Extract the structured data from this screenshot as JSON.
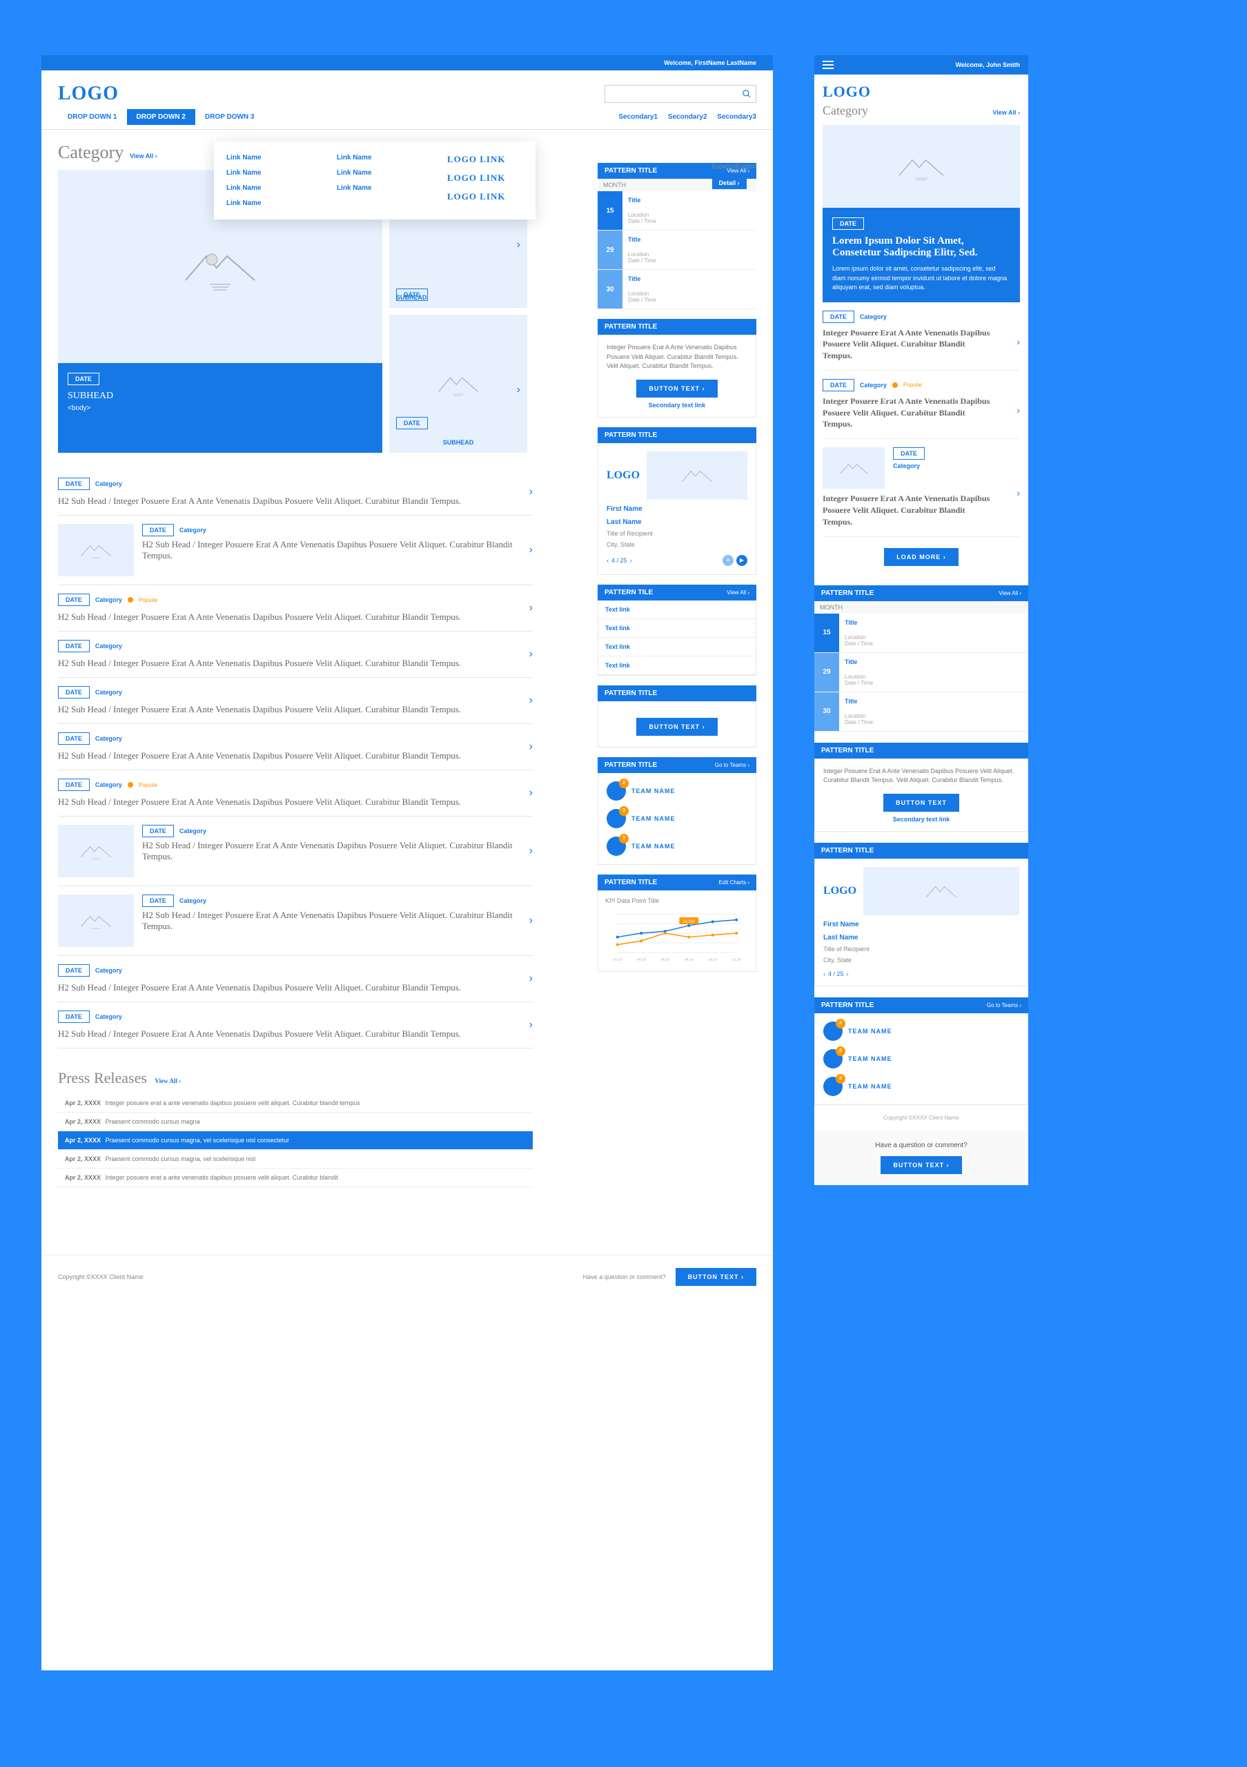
{
  "user_bar": {
    "welcome": "Welcome, FirstName LastName"
  },
  "logo": "LOGO",
  "nav": {
    "main": [
      "DROP DOWN 1",
      "DROP DOWN 2",
      "DROP DOWN 3"
    ],
    "secondary": [
      "Secondary1",
      "Secondary2",
      "Secondary3"
    ]
  },
  "mega": {
    "col1": [
      "Link Name",
      "Link Name",
      "Link Name",
      "Link Name"
    ],
    "col2": [
      "Link Name",
      "Link Name",
      "Link Name"
    ],
    "col3": [
      "LOGO LINK",
      "LOGO LINK",
      "LOGO LINK"
    ]
  },
  "category_title": "Category",
  "view_all": "View All ›",
  "lang": {
    "es": "Español",
    "en": "|English",
    "detail": "Detail ›"
  },
  "hero": {
    "date": "DATE",
    "subhead": "SUBHEAD",
    "body": "<body>",
    "subhead2": "SUBHEAD"
  },
  "calendar": {
    "title": "PATTERN TITLE",
    "month": "MONTH",
    "items": [
      {
        "d": "15",
        "title": "Title",
        "loc": "Location",
        "dt": "Date / Time"
      },
      {
        "d": "29",
        "title": "Title",
        "loc": "Location",
        "dt": "Date / Time"
      },
      {
        "d": "30",
        "title": "Title",
        "loc": "Location",
        "dt": "Date / Time"
      }
    ]
  },
  "cta1": {
    "title": "PATTERN TITLE",
    "text": "Integer Posuere Erat A Ante Venenatis Dapibus Posuere Velit Aliquet.  Curabitur Blandit Tempus.  Velit Aliquet. Curabitur Blandit Tempus.",
    "button": "BUTTON TEXT ›",
    "secondary": "Secondary text link"
  },
  "recipient": {
    "title": "PATTERN TITLE",
    "logo": "LOGO",
    "first": "First Name",
    "last": "Last Name",
    "role": "Title of Recipient",
    "city": "City, State",
    "pager": "4 / 25"
  },
  "linklist": {
    "title": "PATTERN TILE",
    "links": [
      "Text link",
      "Text link",
      "Text link",
      "Text link"
    ]
  },
  "cta2": {
    "title": "PATTERN TITLE",
    "button": "BUTTON TEXT ›"
  },
  "teams": {
    "title": "PATTERN TITLE",
    "go": "Go to Teams ›",
    "items": [
      "TEAM NAME",
      "TEAM NAME",
      "TEAM NAME"
    ],
    "badges": [
      "2",
      "3",
      "3"
    ]
  },
  "kpi": {
    "title": "PATTERN TITLE",
    "edit": "Edit Charts ›",
    "subtitle": "KPI Data Point Title"
  },
  "list_common": {
    "date": "DATE",
    "cat": "Category",
    "popular": "Popular",
    "h2a": "H2 Sub Head / Integer Posuere Erat A Ante Venenatis Dapibus Posuere Velit Aliquet. Curabitur Blandit Tempus.",
    "h2b": "H2 Sub Head / Integer Posuere Erat A Ante Venenatis Dapibus Posuere Velit Aliquet. Curabitur Blandit Tempus."
  },
  "press": {
    "title": "Press Releases",
    "items": [
      {
        "d": "Apr 2, XXXX",
        "t": "Integer posuere erat a ante venenatis dapibus posuere velit aliquet. Curabitur blandit tempus",
        "hl": false
      },
      {
        "d": "Apr 2, XXXX",
        "t": "Praesent commodo cursus magna",
        "hl": false
      },
      {
        "d": "Apr 2, XXXX",
        "t": "Praesent commodo cursus magna, vel scelerisque nisl consectetur",
        "hl": true
      },
      {
        "d": "Apr 2, XXXX",
        "t": "Praesent commodo cursus magna, vel scelerisque nisl",
        "hl": false
      },
      {
        "d": "Apr 2, XXXX",
        "t": "Integer posuere erat a ante venenatis dapibus posuere velit aliquet. Curabitur blandit",
        "hl": false
      }
    ]
  },
  "footer": {
    "copyright": "Copyright ©XXXX Client Name",
    "question": "Have a question or comment?",
    "button": "BUTTON TEXT ›"
  },
  "chart_data": {
    "type": "line",
    "title": "KPI Data Point Title",
    "x": [
      "02.19",
      "04.19",
      "06.19",
      "08.19",
      "10.19",
      "12.19"
    ],
    "series": [
      {
        "name": "blue",
        "values": [
          8,
          10,
          11,
          14,
          16,
          17
        ],
        "color": "#1678e5"
      },
      {
        "name": "orange",
        "values": [
          4,
          6,
          10,
          8,
          9,
          10
        ],
        "color": "#ff9800"
      }
    ],
    "badge": "14,500",
    "ylim": [
      0,
      20
    ]
  },
  "mobile": {
    "welcome": "Welcome, John Smith",
    "hero": {
      "headline": "Lorem Ipsum Dolor Sit Amet, Consetetur Sadipscing Elitr, Sed.",
      "body": "Lorem ipsum dolor sit amet, consetetur sadipscing elitr, sed diam nonumy eirmod tempor invidunt ut labore et dolore magna aliquyam erat, sed diam voluptua."
    },
    "item_text": "Integer Posuere Erat A Ante Venenatis Dapibus Posuere Velit Aliquet. Curabitur Blandit Tempus.",
    "load_more": "LOAD MORE ›",
    "cta_button": "BUTTON TEXT",
    "cta_button2": "BUTTON TEXT ›"
  }
}
